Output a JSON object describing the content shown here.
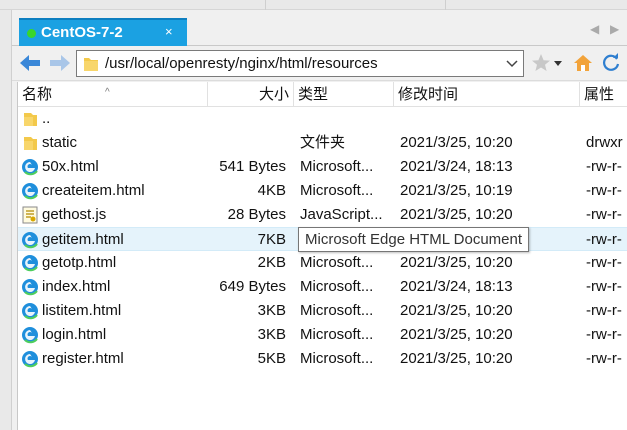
{
  "tab": {
    "title": "CentOS-7-2",
    "close": "×",
    "status_color": "#39d62b",
    "accent": "#1ba1e2"
  },
  "tab_nav": {
    "prev": "◀",
    "next": "▶"
  },
  "toolbar": {
    "path": "/usr/local/openresty/nginx/html/resources"
  },
  "columns": {
    "name": "名称",
    "size": "大小",
    "type": "类型",
    "date": "修改时间",
    "attr": "属性"
  },
  "rows": [
    {
      "name": "..",
      "size": "",
      "type": "",
      "date": "",
      "attr": "",
      "icon": "folder-icon"
    },
    {
      "name": "static",
      "size": "",
      "type": "文件夹",
      "date": "2021/3/25, 10:20",
      "attr": "drwxr",
      "icon": "folder-icon"
    },
    {
      "name": "50x.html",
      "size": "541 Bytes",
      "type": "Microsoft...",
      "date": "2021/3/24, 18:13",
      "attr": "-rw-r-",
      "icon": "edge-icon"
    },
    {
      "name": "createitem.html",
      "size": "4KB",
      "type": "Microsoft...",
      "date": "2021/3/25, 10:19",
      "attr": "-rw-r-",
      "icon": "edge-icon"
    },
    {
      "name": "gethost.js",
      "size": "28 Bytes",
      "type": "JavaScript...",
      "date": "2021/3/25, 10:20",
      "attr": "-rw-r-",
      "icon": "script-file-icon"
    },
    {
      "name": "getitem.html",
      "size": "7KB",
      "type": "Microsoft...",
      "date": "2021/3/25, 10:20",
      "attr": "-rw-r-",
      "icon": "edge-icon"
    },
    {
      "name": "getotp.html",
      "size": "2KB",
      "type": "Microsoft...",
      "date": "2021/3/25, 10:20",
      "attr": "-rw-r-",
      "icon": "edge-icon"
    },
    {
      "name": "index.html",
      "size": "649 Bytes",
      "type": "Microsoft...",
      "date": "2021/3/24, 18:13",
      "attr": "-rw-r-",
      "icon": "edge-icon"
    },
    {
      "name": "listitem.html",
      "size": "3KB",
      "type": "Microsoft...",
      "date": "2021/3/25, 10:20",
      "attr": "-rw-r-",
      "icon": "edge-icon"
    },
    {
      "name": "login.html",
      "size": "3KB",
      "type": "Microsoft...",
      "date": "2021/3/25, 10:20",
      "attr": "-rw-r-",
      "icon": "edge-icon"
    },
    {
      "name": "register.html",
      "size": "5KB",
      "type": "Microsoft...",
      "date": "2021/3/25, 10:20",
      "attr": "-rw-r-",
      "icon": "edge-icon"
    }
  ],
  "tooltip": {
    "text": "Microsoft Edge HTML Document"
  }
}
